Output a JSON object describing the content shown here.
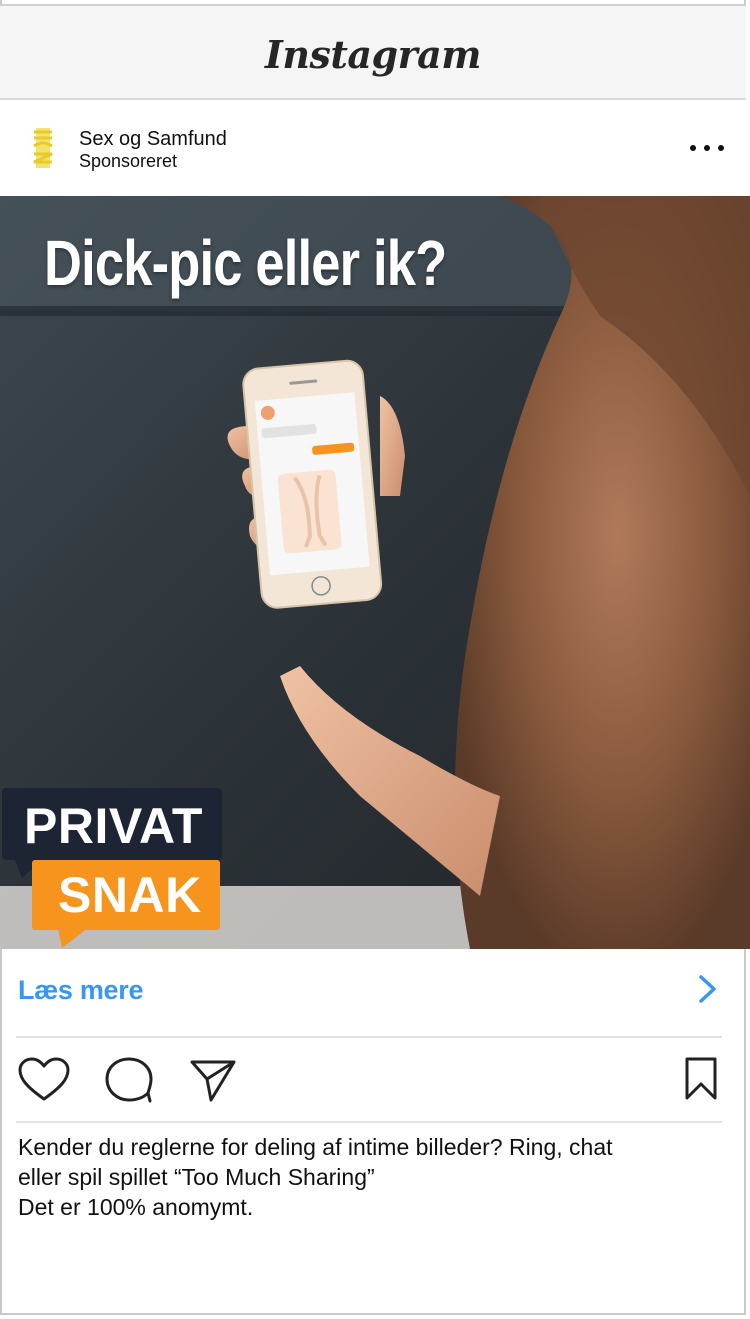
{
  "app": {
    "title": "Instagram"
  },
  "post": {
    "account_name": "Sex og Samfund",
    "sponsored_label": "Sponsoreret",
    "more_icon": "more-horizontal-icon"
  },
  "image": {
    "headline": "Dick-pic eller ik?",
    "badge_top": "PRIVAT",
    "badge_bottom": "SNAK",
    "badge_colors": {
      "top": "#1d2433",
      "bottom": "#f7941d"
    }
  },
  "cta": {
    "label": "Læs mere",
    "color": "#3897f0",
    "icon": "chevron-right-icon"
  },
  "actions": {
    "like_icon": "heart-icon",
    "comment_icon": "comment-icon",
    "share_icon": "send-icon",
    "save_icon": "bookmark-icon"
  },
  "caption": {
    "line1": "Kender du reglerne for deling af intime billeder? Ring, chat",
    "line2": "eller spil spillet “Too Much Sharing”",
    "line3": "Det er 100% anomymt."
  }
}
